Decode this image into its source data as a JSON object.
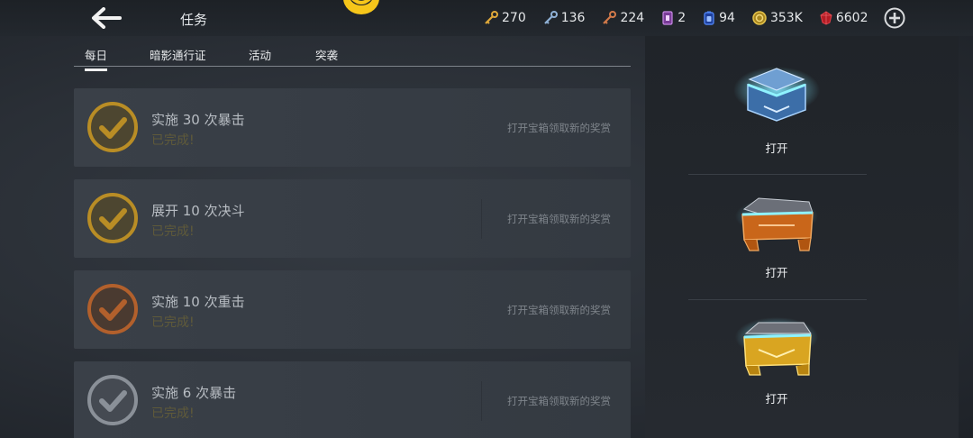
{
  "header": {
    "title": "任务",
    "resources": [
      {
        "name": "gold-key",
        "icon": "key-icon",
        "color": "#e0a93a",
        "value": "270"
      },
      {
        "name": "silver-key",
        "icon": "key-icon",
        "color": "#8fb1d6",
        "value": "136"
      },
      {
        "name": "bronze-key",
        "icon": "key-icon",
        "color": "#d27a4a",
        "value": "224"
      },
      {
        "name": "ticket",
        "icon": "ticket-icon",
        "color": "#b36ad6",
        "value": "2"
      },
      {
        "name": "energy",
        "icon": "battery-icon",
        "color": "#3f6fe0",
        "value": "94"
      },
      {
        "name": "coins",
        "icon": "coin-icon",
        "color": "#d9b43a",
        "value": "353K"
      },
      {
        "name": "gems",
        "icon": "gem-icon",
        "color": "#c8232c",
        "value": "6602"
      }
    ]
  },
  "tabs": [
    {
      "label": "每日",
      "active": true
    },
    {
      "label": "暗影通行证",
      "active": false
    },
    {
      "label": "活动",
      "active": false
    },
    {
      "label": "突袭",
      "active": false
    }
  ],
  "missions": [
    {
      "name": "实施 30 次暴击",
      "status": "已完成!",
      "hint": "打开宝箱领取新的奖赏",
      "tier": "gold",
      "color": "#b98d25"
    },
    {
      "name": "展开 10 次决斗",
      "status": "已完成!",
      "hint": "打开宝箱领取新的奖赏",
      "tier": "gold",
      "color": "#b98d25"
    },
    {
      "name": "实施 10 次重击",
      "status": "已完成!",
      "hint": "打开宝箱领取新的奖赏",
      "tier": "bronze",
      "color": "#b2602c"
    },
    {
      "name": "实施 6 次暴击",
      "status": "已完成!",
      "hint": "打开宝箱领取新的奖赏",
      "tier": "silver",
      "color": "#8a9098"
    }
  ],
  "chests": [
    {
      "tier": "silver",
      "open_label": "打开",
      "color": "#4d86c8"
    },
    {
      "tier": "bronze",
      "open_label": "打开",
      "color": "#d0741c"
    },
    {
      "tier": "gold",
      "open_label": "打开",
      "color": "#e0b531"
    }
  ]
}
